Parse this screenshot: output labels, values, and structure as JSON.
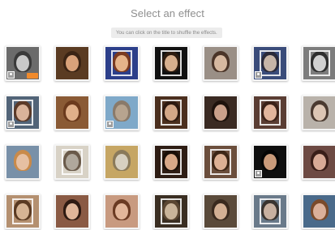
{
  "header": {
    "title": "Select an effect",
    "hint": "You can click on the title to shuffle the effects."
  },
  "effects": [
    {
      "row": 0,
      "col": 0,
      "bg": "#6b6b6b",
      "skin": "#c9c9c9",
      "hair": "#3a3a3a",
      "frame": false,
      "badge": true,
      "tag": true
    },
    {
      "row": 0,
      "col": 1,
      "bg": "#5a3b22",
      "skin": "#d9a27a",
      "hair": "#3b2414",
      "frame": false,
      "badge": false,
      "tag": false
    },
    {
      "row": 0,
      "col": 2,
      "bg": "#2c3f8a",
      "skin": "#e6b48a",
      "hair": "#7a3a20",
      "frame": true,
      "badge": false,
      "tag": false
    },
    {
      "row": 0,
      "col": 3,
      "bg": "#111111",
      "skin": "#d8b08e",
      "hair": "#2d1c10",
      "frame": true,
      "badge": false,
      "tag": false
    },
    {
      "row": 0,
      "col": 4,
      "bg": "#9a8f86",
      "skin": "#d6b8a0",
      "hair": "#4a3428",
      "frame": false,
      "badge": false,
      "tag": false
    },
    {
      "row": 0,
      "col": 5,
      "bg": "#3a4c7a",
      "skin": "#c7b5a7",
      "hair": "#2a2a3a",
      "frame": true,
      "badge": true,
      "tag": false
    },
    {
      "row": 0,
      "col": 6,
      "bg": "#7d7d7d",
      "skin": "#d0d0d0",
      "hair": "#2e2e2e",
      "frame": true,
      "badge": false,
      "tag": false
    },
    {
      "row": 1,
      "col": 0,
      "bg": "#526478",
      "skin": "#d9b39a",
      "hair": "#5b3a28",
      "frame": true,
      "badge": true,
      "tag": false
    },
    {
      "row": 1,
      "col": 1,
      "bg": "#8a5a35",
      "skin": "#e0b08a",
      "hair": "#6b3a1d",
      "frame": false,
      "badge": false,
      "tag": false
    },
    {
      "row": 1,
      "col": 2,
      "bg": "#7fa9c9",
      "skin": "#b7a48f",
      "hair": "#8a7a6a",
      "frame": false,
      "badge": true,
      "tag": false
    },
    {
      "row": 1,
      "col": 3,
      "bg": "#4b2f1e",
      "skin": "#d3a787",
      "hair": "#2e1a10",
      "frame": true,
      "badge": false,
      "tag": false
    },
    {
      "row": 1,
      "col": 4,
      "bg": "#3a2a22",
      "skin": "#caa08a",
      "hair": "#1e120c",
      "frame": false,
      "badge": false,
      "tag": false
    },
    {
      "row": 1,
      "col": 5,
      "bg": "#5a3d33",
      "skin": "#e1b59c",
      "hair": "#3b2218",
      "frame": true,
      "badge": false,
      "tag": false
    },
    {
      "row": 1,
      "col": 6,
      "bg": "#b9b2aa",
      "skin": "#dcc6b4",
      "hair": "#4a3a30",
      "frame": false,
      "badge": false,
      "tag": false
    },
    {
      "row": 2,
      "col": 0,
      "bg": "#7890a8",
      "skin": "#e6c0a3",
      "hair": "#c98a4a",
      "frame": false,
      "badge": false,
      "tag": false
    },
    {
      "row": 2,
      "col": 1,
      "bg": "#d8d2c6",
      "skin": "#b0a89c",
      "hair": "#6a5a4a",
      "frame": true,
      "badge": false,
      "tag": false
    },
    {
      "row": 2,
      "col": 2,
      "bg": "#c6a664",
      "skin": "#d7d0c0",
      "hair": "#8a7a5a",
      "frame": false,
      "badge": false,
      "tag": false
    },
    {
      "row": 2,
      "col": 3,
      "bg": "#2e1d14",
      "skin": "#d8a888",
      "hair": "#1a0f08",
      "frame": true,
      "badge": false,
      "tag": false
    },
    {
      "row": 2,
      "col": 4,
      "bg": "#6b4e3c",
      "skin": "#dcb094",
      "hair": "#3d2616",
      "frame": true,
      "badge": false,
      "tag": false
    },
    {
      "row": 2,
      "col": 5,
      "bg": "#0e0e0e",
      "skin": "#c99a7a",
      "hair": "#050505",
      "frame": false,
      "badge": true,
      "tag": false
    },
    {
      "row": 2,
      "col": 6,
      "bg": "#6d4a43",
      "skin": "#d8aa96",
      "hair": "#3a1e18",
      "frame": false,
      "badge": false,
      "tag": false
    },
    {
      "row": 3,
      "col": 0,
      "bg": "#b49070",
      "skin": "#d6b494",
      "hair": "#5a3a22",
      "frame": true,
      "badge": false,
      "tag": false
    },
    {
      "row": 3,
      "col": 1,
      "bg": "#8a5a44",
      "skin": "#e0b69a",
      "hair": "#2e1a12",
      "frame": false,
      "badge": false,
      "tag": false
    },
    {
      "row": 3,
      "col": 2,
      "bg": "#c89a80",
      "skin": "#e2b69a",
      "hair": "#6a3a22",
      "frame": false,
      "badge": false,
      "tag": false
    },
    {
      "row": 3,
      "col": 3,
      "bg": "#3a2e22",
      "skin": "#c9b49a",
      "hair": "#5a4632",
      "frame": true,
      "badge": false,
      "tag": false
    },
    {
      "row": 3,
      "col": 4,
      "bg": "#5a4a3a",
      "skin": "#d3b094",
      "hair": "#3a2a1e",
      "frame": false,
      "badge": false,
      "tag": false
    },
    {
      "row": 3,
      "col": 5,
      "bg": "#6a7a8a",
      "skin": "#c8b0a0",
      "hair": "#3a3430",
      "frame": true,
      "badge": false,
      "tag": false
    },
    {
      "row": 3,
      "col": 6,
      "bg": "#4a6a8a",
      "skin": "#dab09a",
      "hair": "#7a4a2a",
      "frame": false,
      "badge": false,
      "tag": false
    }
  ]
}
